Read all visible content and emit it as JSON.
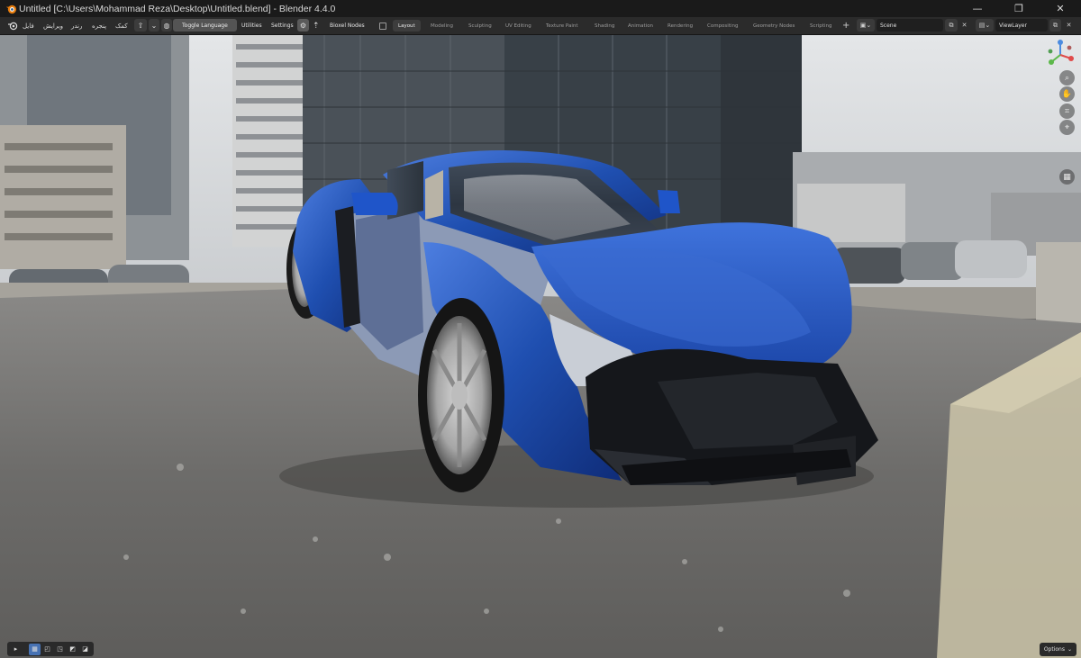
{
  "window": {
    "title": "Untitled [C:\\Users\\Mohammad Reza\\Desktop\\Untitled.blend] - Blender 4.4.0",
    "controls": {
      "minimize": "—",
      "maximize": "❐",
      "close": "✕"
    }
  },
  "menu": {
    "items": [
      "فایل",
      "ویرایش",
      "رندر",
      "پنجره",
      "کمک"
    ]
  },
  "toolbar": {
    "toggle_language": "Toggle Language",
    "utilities": "Utilities",
    "settings": "Settings",
    "bioxel_nodes": "Bioxel Nodes"
  },
  "workspaces": {
    "tabs": [
      "Layout",
      "Modeling",
      "Sculpting",
      "UV Editing",
      "Texture Paint",
      "Shading",
      "Animation",
      "Rendering",
      "Compositing",
      "Geometry Nodes",
      "Scripting"
    ],
    "active": "Layout",
    "add": "+"
  },
  "scene": {
    "value": "Scene"
  },
  "view_layer": {
    "value": "ViewLayer"
  },
  "viewport": {
    "options_label": "Options",
    "icons": [
      "zoom-icon",
      "hand-pan-icon",
      "camera-view-icon",
      "grid-perspective-icon",
      "view-layout-icon"
    ]
  },
  "colors": {
    "accent": "#4772b3",
    "topbar_bg": "#2b2b2b",
    "car_body": "#1f4fb0"
  }
}
